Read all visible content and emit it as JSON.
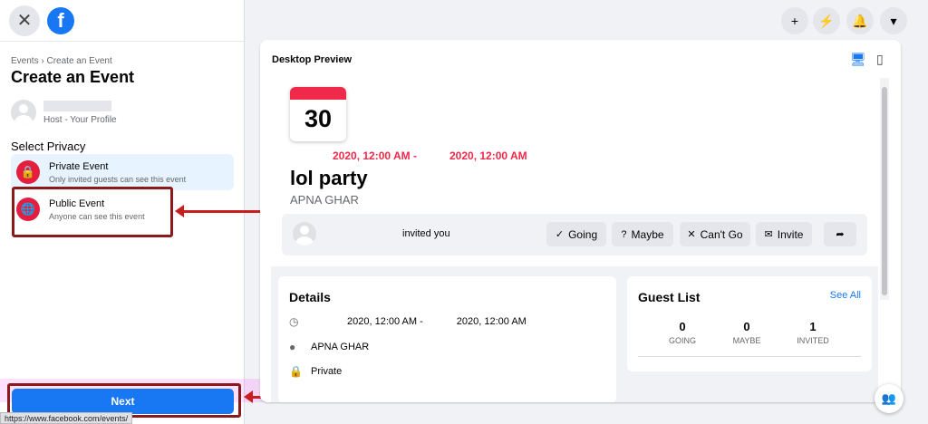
{
  "sidebar": {
    "breadcrumb": [
      "Events",
      "Create an Event"
    ],
    "breadcrumb_sep": "›",
    "title": "Create an Event",
    "host_subtitle": "Host - Your Profile",
    "privacy_label": "Select Privacy",
    "options": [
      {
        "title": "Private Event",
        "subtitle": "Only invited guests can see this event",
        "selected": true
      },
      {
        "title": "Public Event",
        "subtitle": "Anyone can see this event",
        "selected": false
      }
    ],
    "next_label": "Next",
    "status_url": "https://www.facebook.com/events/"
  },
  "header": {
    "icons": [
      "plus-icon",
      "messenger-icon",
      "bell-icon",
      "caret-down-icon"
    ],
    "glyphs": [
      "+",
      "⚡",
      "🔔",
      "▾"
    ]
  },
  "preview": {
    "title": "Desktop Preview",
    "calendar_day": "30",
    "date_start": "2020, 12:00 AM -",
    "date_end": "2020, 12:00 AM",
    "event_title": "lol party",
    "location": "APNA GHAR",
    "invited_text": "invited you",
    "buttons": [
      {
        "label": "Going",
        "icon": "check-circle-icon",
        "glyph": "✓"
      },
      {
        "label": "Maybe",
        "icon": "question-circle-icon",
        "glyph": "?"
      },
      {
        "label": "Can't Go",
        "icon": "x-circle-icon",
        "glyph": "✕"
      },
      {
        "label": "Invite",
        "icon": "envelope-icon",
        "glyph": "✉"
      }
    ],
    "share_glyph": "➦",
    "details": {
      "title": "Details",
      "time_start": "2020, 12:00 AM -",
      "time_end": "2020, 12:00 AM",
      "location": "APNA GHAR",
      "privacy": "Private"
    },
    "guest_list": {
      "title": "Guest List",
      "see_all": "See All",
      "stats": [
        {
          "value": "0",
          "label": "GOING"
        },
        {
          "value": "0",
          "label": "MAYBE"
        },
        {
          "value": "1",
          "label": "INVITED"
        }
      ]
    }
  },
  "colors": {
    "accent": "#1877f2",
    "event_red": "#f02849",
    "highlight_border": "#8b1a1a",
    "arrow": "#c81e1e"
  }
}
